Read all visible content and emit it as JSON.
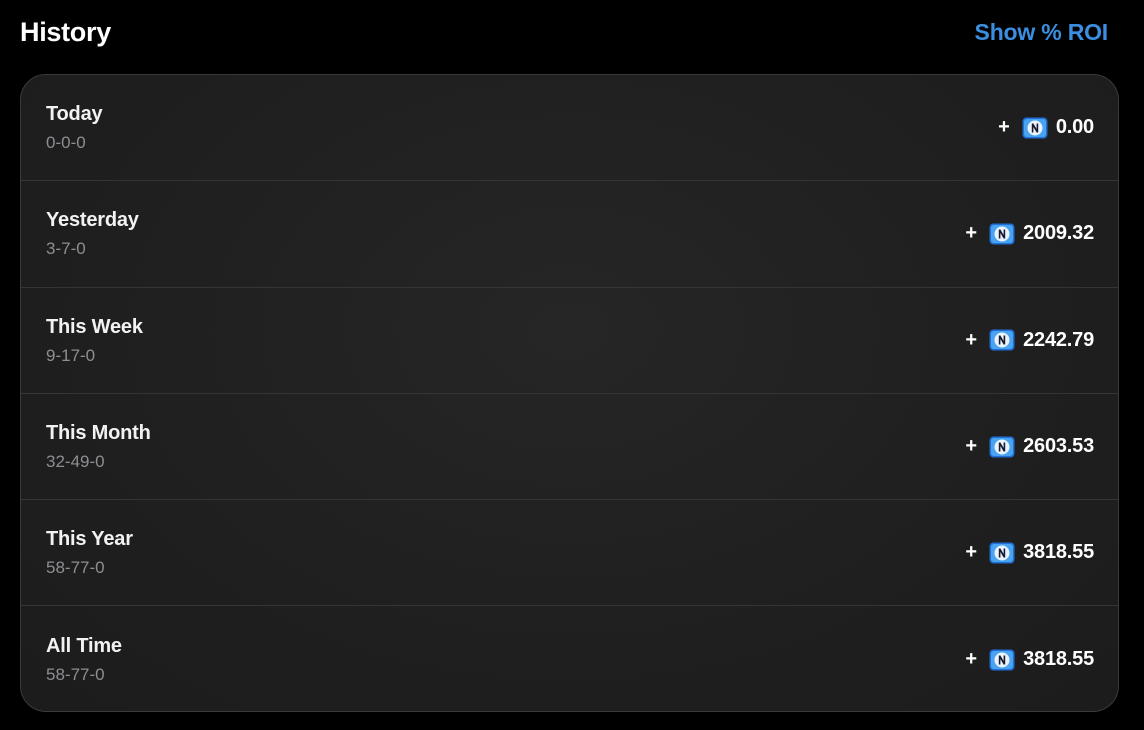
{
  "header": {
    "title": "History",
    "roi_link": "Show % ROI"
  },
  "colors": {
    "background": "#000000",
    "card_background": "#1f1f1f",
    "link_accent": "#3b8fe0",
    "secondary_text": "#8e8e93"
  },
  "coin_icon": "n-coin-icon",
  "rows": [
    {
      "label": "Today",
      "record": "0-0-0",
      "sign": "+",
      "amount": "0.00"
    },
    {
      "label": "Yesterday",
      "record": "3-7-0",
      "sign": "+",
      "amount": "2009.32"
    },
    {
      "label": "This Week",
      "record": "9-17-0",
      "sign": "+",
      "amount": "2242.79"
    },
    {
      "label": "This Month",
      "record": "32-49-0",
      "sign": "+",
      "amount": "2603.53"
    },
    {
      "label": "This Year",
      "record": "58-77-0",
      "sign": "+",
      "amount": "3818.55"
    },
    {
      "label": "All Time",
      "record": "58-77-0",
      "sign": "+",
      "amount": "3818.55"
    }
  ]
}
